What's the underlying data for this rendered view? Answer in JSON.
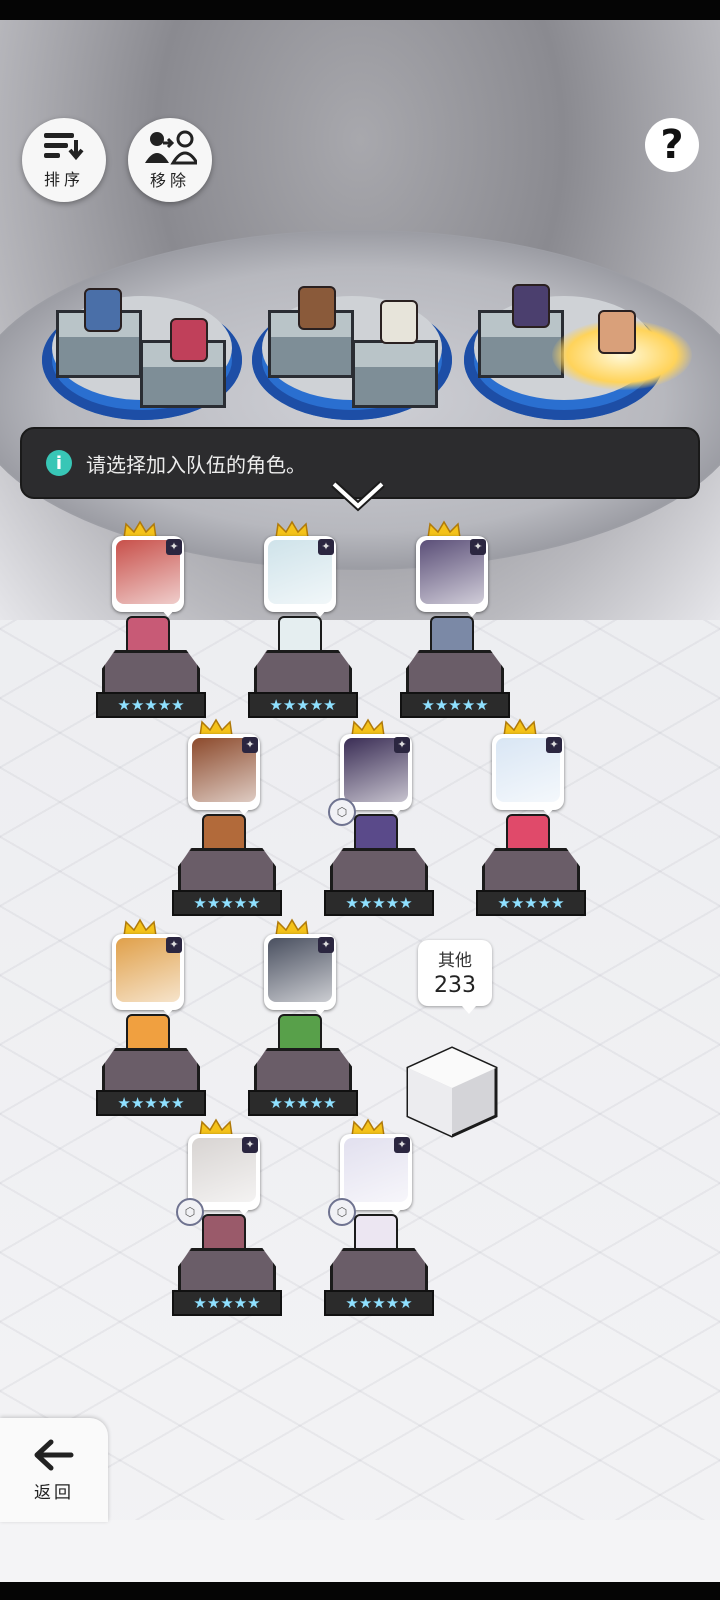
{
  "toolbar": {
    "sort_label": "排序",
    "remove_label": "移除",
    "help_label": "?"
  },
  "notice": {
    "text": "请选择加入队伍的角色。"
  },
  "roster": {
    "heroes": [
      {
        "stars": "★★★★★",
        "face": "#c8504a",
        "sprite": "#c85a76",
        "gear": false
      },
      {
        "stars": "★★★★★",
        "face": "#cfe3ea",
        "sprite": "#e5eef0",
        "gear": false
      },
      {
        "stars": "★★★★★",
        "face": "#5b4f78",
        "sprite": "#7b89a6",
        "gear": false
      },
      {
        "stars": "★★★★★",
        "face": "#8c4a2c",
        "sprite": "#b26a3a",
        "gear": false
      },
      {
        "stars": "★★★★★",
        "face": "#3a2d55",
        "sprite": "#5a4a8a",
        "gear": true
      },
      {
        "stars": "★★★★★",
        "face": "#d9e6f4",
        "sprite": "#e04a6a",
        "gear": false
      },
      {
        "stars": "★★★★★",
        "face": "#e0a04a",
        "sprite": "#f0a040",
        "gear": false
      },
      {
        "stars": "★★★★★",
        "face": "#4a5060",
        "sprite": "#58a04a",
        "gear": false
      },
      {
        "stars": "★★★★★",
        "face": "#d8d4d2",
        "sprite": "#9a5a6a",
        "gear": true
      },
      {
        "stars": "★★★★★",
        "face": "#e2e0ef",
        "sprite": "#ece6f2",
        "gear": true
      }
    ],
    "others": {
      "label": "其他",
      "count": "233"
    }
  },
  "footer": {
    "back_label": "返回"
  },
  "colors": {
    "notice_bg": "#2c2c2e",
    "notice_icon": "#38c6b6",
    "crown": "#f4c21a",
    "pad_blue": "#2a6fd0"
  }
}
